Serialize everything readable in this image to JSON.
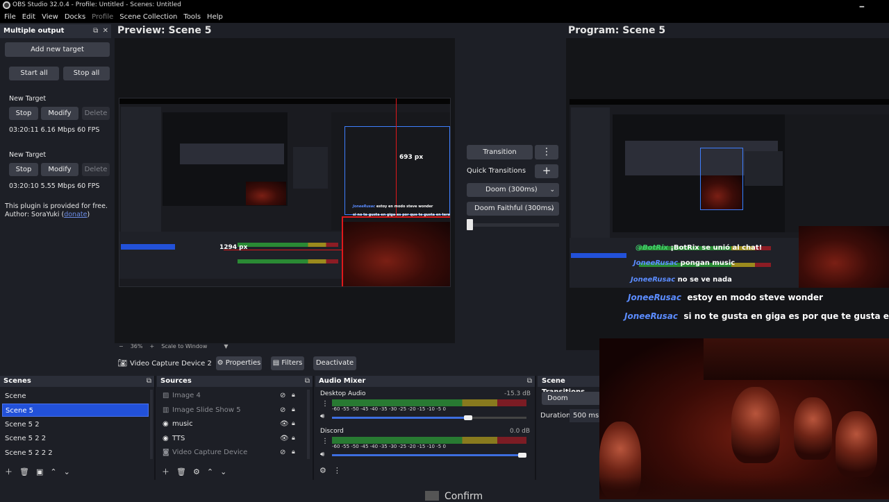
{
  "window": {
    "title": "OBS Studio 32.0.4 - Profile: Untitled - Scenes: Untitled",
    "minimize_glyph": "🗕"
  },
  "menu": [
    "File",
    "Edit",
    "View",
    "Docks",
    "Profile",
    "Scene Collection",
    "Tools",
    "Help"
  ],
  "multiple_output": {
    "title": "Multiple output",
    "add_target": "Add new target",
    "start_all": "Start all",
    "stop_all": "Stop all",
    "targets": [
      {
        "name": "New Target",
        "stop": "Stop",
        "modify": "Modify",
        "delete": "Delete",
        "stats": "03:20:11  6.16 Mbps  60 FPS"
      },
      {
        "name": "New Target",
        "stop": "Stop",
        "modify": "Modify",
        "delete": "Delete",
        "stats": "03:20:10  5.55 Mbps  60 FPS"
      }
    ],
    "plugin_note": "This plugin is provided for free.",
    "author_prefix": "Author: SoraYuki (",
    "author_link": "donate",
    "author_suffix": ")"
  },
  "preview": {
    "label": "Preview: Scene 5",
    "zoom": "36%",
    "zoom_minus": "−",
    "zoom_plus": "+",
    "scale_mode": "Scale to Window",
    "measure_v": "693 px",
    "measure_h": "1294 px"
  },
  "program": {
    "label": "Program: Scene 5"
  },
  "transitions": {
    "transition_button": "Transition",
    "quick_transitions": "Quick Transitions",
    "quick_items": [
      "Doom (300ms)",
      "Doom Faithful (300ms)"
    ],
    "tbar_position": 0.0
  },
  "context": {
    "source_name": "Video Capture Device 2",
    "properties": "Properties",
    "filters": "Filters",
    "deactivate": "Deactivate"
  },
  "scenes": {
    "title": "Scenes",
    "items": [
      "Scene",
      "Scene 5",
      "Scene 5 2",
      "Scene 5 2 2",
      "Scene 5 2 2 2"
    ],
    "selected_index": 1
  },
  "sources": {
    "title": "Sources",
    "items": [
      {
        "name": "Image 4",
        "visible": false,
        "icon": "image-icon"
      },
      {
        "name": "Image Slide Show 5",
        "visible": false,
        "icon": "slideshow-icon"
      },
      {
        "name": "music",
        "visible": true,
        "icon": "browser-icon"
      },
      {
        "name": "TTS",
        "visible": true,
        "icon": "browser-icon"
      },
      {
        "name": "Video Capture Device",
        "visible": false,
        "icon": "camera-icon"
      }
    ]
  },
  "mixer": {
    "title": "Audio Mixer",
    "ticks": "-60  -55  -50  -45  -40  -35  -30  -25  -20  -15  -10   -5    0",
    "channels": [
      {
        "name": "Desktop Audio",
        "db": "-15.3 dB",
        "volume": 0.72
      },
      {
        "name": "Discord",
        "db": "0.0 dB",
        "volume": 1.0
      }
    ]
  },
  "scene_transitions": {
    "title": "Scene Transitions",
    "current": "Doom",
    "duration_label": "Duration",
    "duration_value": "500 ms"
  },
  "overlay": {
    "chat": [
      {
        "user": "JoneeRusac",
        "message": "estoy en modo steve wonder"
      },
      {
        "user": "JoneeRusac",
        "message": "si no te gusta en giga es por que te gusta en tera"
      }
    ],
    "mini_chat": [
      {
        "user": "@BotRix",
        "message": "¡BotRix se unió al chat!"
      },
      {
        "user": "JoneeRusac",
        "message": "pongan music"
      },
      {
        "user": "JoneeRusac",
        "message": "no se ve nada"
      }
    ],
    "confirm": "Confirm"
  },
  "colors": {
    "accent": "#2251d9",
    "selection_red": "#e0181b",
    "selection_blue": "#3f7fff",
    "chat_user": "#5b8cff"
  }
}
